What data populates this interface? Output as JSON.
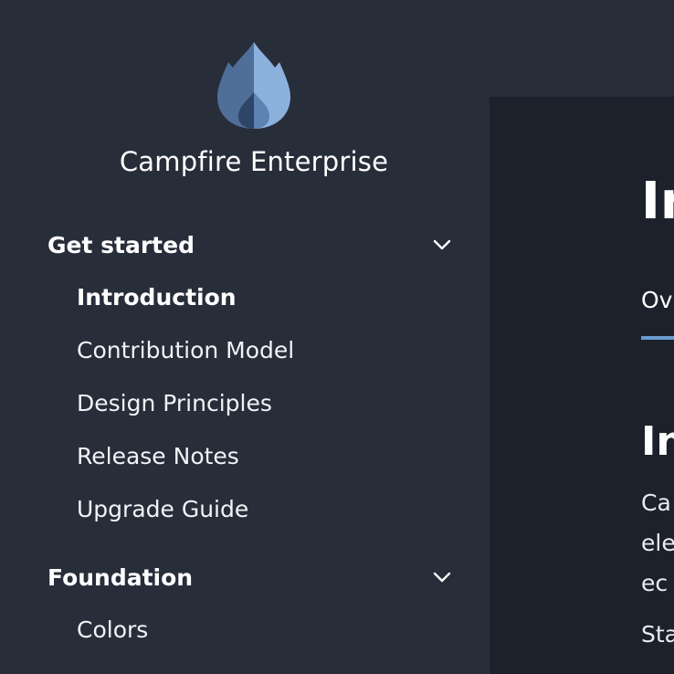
{
  "brand": {
    "name": "Campfire Enterprise",
    "logo_icon": "flame-icon",
    "logo_colors": [
      "#4f6f99",
      "#8db1dd",
      "#2d4567"
    ]
  },
  "sidebar": {
    "sections": [
      {
        "label": "Get started",
        "expanded": true,
        "items": [
          {
            "label": "Introduction",
            "active": true
          },
          {
            "label": "Contribution Model",
            "active": false
          },
          {
            "label": "Design Principles",
            "active": false
          },
          {
            "label": "Release Notes",
            "active": false
          },
          {
            "label": "Upgrade Guide",
            "active": false
          }
        ]
      },
      {
        "label": "Foundation",
        "expanded": true,
        "items": [
          {
            "label": "Colors",
            "active": false
          }
        ]
      }
    ]
  },
  "main": {
    "title": "In",
    "tab_label": "Ov",
    "section_title": "In",
    "paragraph_lines": [
      "Ca",
      "ele",
      "ec"
    ],
    "paragraph2": "Sta"
  },
  "colors": {
    "sidebar_bg": "#282d3a",
    "content_bg": "#1c212b",
    "accent": "#6b9bd2",
    "text": "#ffffff"
  }
}
